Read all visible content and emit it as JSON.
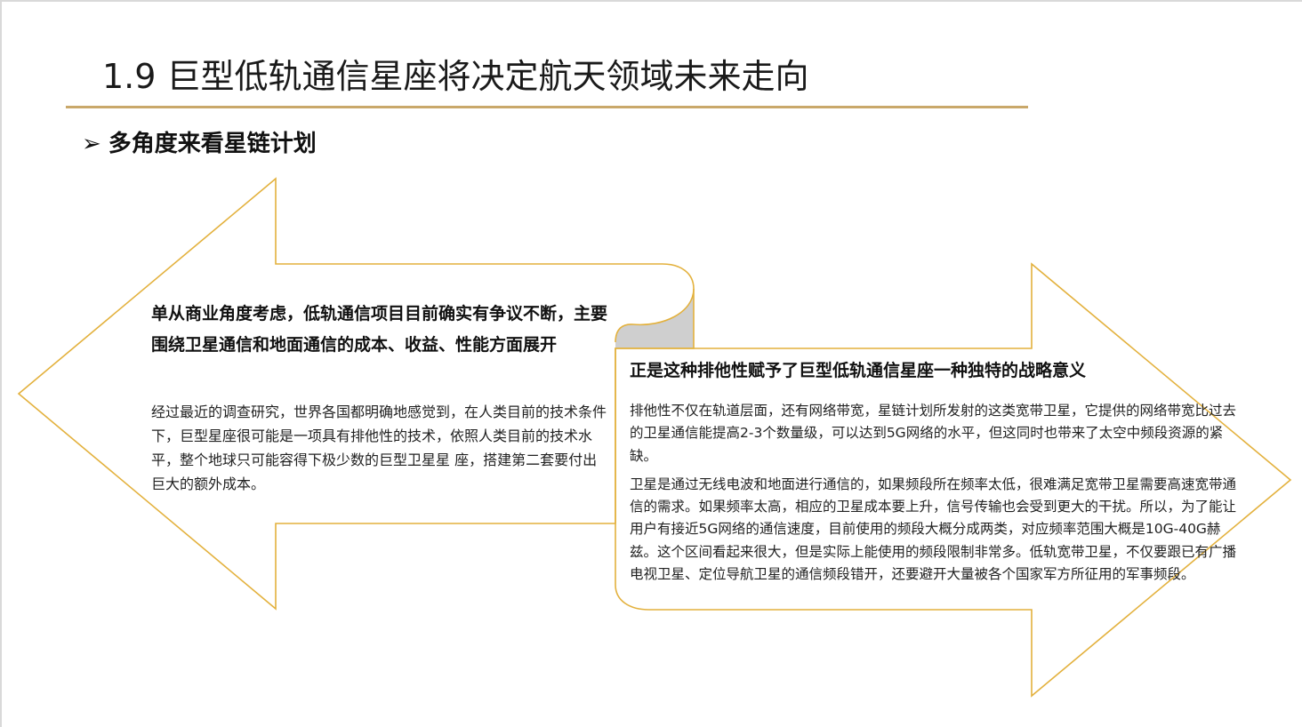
{
  "slide": {
    "title": "1.9 巨型低轨通信星座将决定航天领域未来走向",
    "subtitle_marker": "➢",
    "subtitle": "多角度来看星链计划"
  },
  "left_panel": {
    "heading": "单从商业角度考虑，低轨通信项目目前确实有争议不断，主要围绕卫星通信和地面通信的成本、收益、性能方面展开",
    "body": "经过最近的调查研究，世界各国都明确地感觉到，在人类目前的技术条件下，巨型星座很可能是一项具有排他性的技术，依照人类目前的技术水平，整个地球只可能容得下极少数的巨型卫星星 座，搭建第二套要付出巨大的额外成本。"
  },
  "right_panel": {
    "heading": "正是这种排他性赋予了巨型低轨通信星座一种独特的战略意义",
    "paragraphs": [
      "排他性不仅在轨道层面，还有网络带宽，星链计划所发射的这类宽带卫星，它提供的网络带宽比过去的卫星通信能提高2-3个数量级，可以达到5G网络的水平，但这同时也带来了太空中频段资源的紧缺。",
      "卫星是通过无线电波和地面进行通信的，如果频段所在频率太低，很难满足宽带卫星需要高速宽带通信的需求。如果频率太高，相应的卫星成本要上升，信号传输也会受到更大的干扰。所以，为了能让用户有接近5G网络的通信速度，目前使用的频段大概分成两类，对应频率范围大概是10G-40G赫兹。这个区间看起来很大，但是实际上能使用的频段限制非常多。低轨宽带卫星，不仅要跟已有广播电视卫星、定位导航卫星的通信频段错开，还要避开大量被各个国家军方所征用的军事频段。"
    ]
  },
  "colors": {
    "accent_gold": "#c9a86a",
    "arrow_outline": "#e3b13d",
    "fold_shadow": "#cfcfcf"
  }
}
